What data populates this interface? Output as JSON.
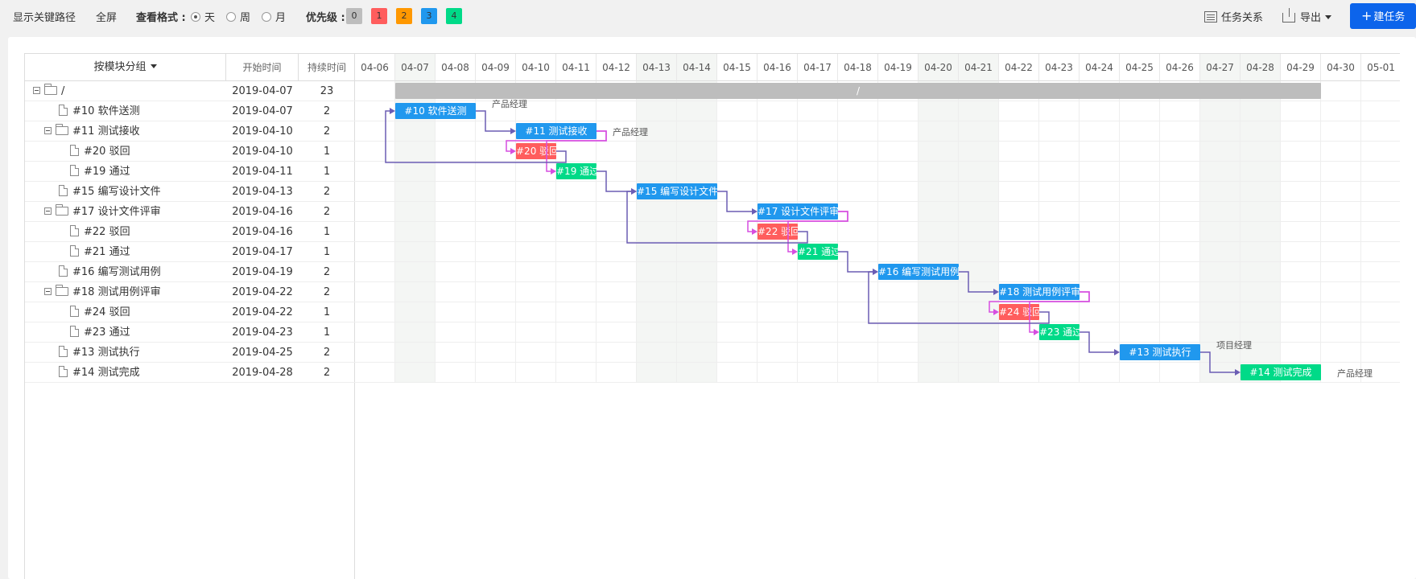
{
  "toolbar": {
    "critical_path": "显示关键路径",
    "fullscreen": "全屏",
    "view_format_label": "查看格式 :",
    "view_options": [
      "天",
      "周",
      "月"
    ],
    "view_selected": "天",
    "priority_label": "优先级 :",
    "priorities": [
      {
        "label": "0",
        "color": "#bdbdbd"
      },
      {
        "label": "1",
        "color": "#ff5d5d"
      },
      {
        "label": "2",
        "color": "#ff9800"
      },
      {
        "label": "3",
        "color": "#2098ee"
      },
      {
        "label": "4",
        "color": "#00da88"
      }
    ],
    "task_relations": "任务关系",
    "export": "导出",
    "new_task": "建任务"
  },
  "columns": {
    "group": "按模块分组",
    "start": "开始时间",
    "duration": "持续时间"
  },
  "days": [
    "04-06",
    "04-07",
    "04-08",
    "04-09",
    "04-10",
    "04-11",
    "04-12",
    "04-13",
    "04-14",
    "04-15",
    "04-16",
    "04-17",
    "04-18",
    "04-19",
    "04-20",
    "04-21",
    "04-22",
    "04-23",
    "04-24",
    "04-25",
    "04-26",
    "04-27",
    "04-28",
    "04-29",
    "04-30",
    "05-01"
  ],
  "weekend_days": [
    "04-07",
    "04-13",
    "04-14",
    "04-20",
    "04-21",
    "04-27",
    "04-28"
  ],
  "colors": {
    "gray": "#bdbdbd",
    "blue": "#2098ee",
    "red": "#ff5d5d",
    "green": "#00da88",
    "link_purple": "#6b5db4",
    "link_magenta": "#d64ee0"
  },
  "tasks": [
    {
      "name": "/",
      "start": "2019-04-07",
      "duration": "23",
      "kind": "folder",
      "level": 0,
      "bar_label": "/",
      "color": "gray",
      "assignee": ""
    },
    {
      "name": "#10 软件送测",
      "start": "2019-04-07",
      "duration": "2",
      "kind": "file",
      "level": 1,
      "bar_label": "#10 软件送测",
      "color": "blue",
      "assignee": "产品经理"
    },
    {
      "name": "#11 测试接收",
      "start": "2019-04-10",
      "duration": "2",
      "kind": "folder",
      "level": 1,
      "bar_label": "#11 测试接收",
      "color": "blue",
      "assignee": "产品经理"
    },
    {
      "name": "#20 驳回",
      "start": "2019-04-10",
      "duration": "1",
      "kind": "file",
      "level": 2,
      "bar_label": "#20 驳回",
      "color": "red",
      "assignee": ""
    },
    {
      "name": "#19 通过",
      "start": "2019-04-11",
      "duration": "1",
      "kind": "file",
      "level": 2,
      "bar_label": "#19 通过",
      "color": "green",
      "assignee": ""
    },
    {
      "name": "#15 编写设计文件",
      "start": "2019-04-13",
      "duration": "2",
      "kind": "file",
      "level": 1,
      "bar_label": "#15 编写设计文件",
      "color": "blue",
      "assignee": ""
    },
    {
      "name": "#17 设计文件评审",
      "start": "2019-04-16",
      "duration": "2",
      "kind": "folder",
      "level": 1,
      "bar_label": "#17 设计文件评审",
      "color": "blue",
      "assignee": ""
    },
    {
      "name": "#22 驳回",
      "start": "2019-04-16",
      "duration": "1",
      "kind": "file",
      "level": 2,
      "bar_label": "#22 驳回",
      "color": "red",
      "assignee": ""
    },
    {
      "name": "#21 通过",
      "start": "2019-04-17",
      "duration": "1",
      "kind": "file",
      "level": 2,
      "bar_label": "#21 通过",
      "color": "green",
      "assignee": ""
    },
    {
      "name": "#16 编写测试用例",
      "start": "2019-04-19",
      "duration": "2",
      "kind": "file",
      "level": 1,
      "bar_label": "#16 编写测试用例",
      "color": "blue",
      "assignee": ""
    },
    {
      "name": "#18 测试用例评审",
      "start": "2019-04-22",
      "duration": "2",
      "kind": "folder",
      "level": 1,
      "bar_label": "#18 测试用例评审",
      "color": "blue",
      "assignee": ""
    },
    {
      "name": "#24 驳回",
      "start": "2019-04-22",
      "duration": "1",
      "kind": "file",
      "level": 2,
      "bar_label": "#24 驳回",
      "color": "red",
      "assignee": ""
    },
    {
      "name": "#23 通过",
      "start": "2019-04-23",
      "duration": "1",
      "kind": "file",
      "level": 2,
      "bar_label": "#23 通过",
      "color": "green",
      "assignee": ""
    },
    {
      "name": "#13 测试执行",
      "start": "2019-04-25",
      "duration": "2",
      "kind": "file",
      "level": 1,
      "bar_label": "#13 测试执行",
      "color": "blue",
      "assignee": "项目经理"
    },
    {
      "name": "#14 测试完成",
      "start": "2019-04-28",
      "duration": "2",
      "kind": "file",
      "level": 1,
      "bar_label": "#14 测试完成",
      "color": "green",
      "assignee": "产品经理"
    }
  ],
  "links": [
    {
      "from": 1,
      "to": 2,
      "color": "link_purple"
    },
    {
      "from": 2,
      "to": 3,
      "color": "link_magenta"
    },
    {
      "from": 2,
      "to": 4,
      "color": "link_magenta"
    },
    {
      "from": 3,
      "to": 1,
      "color": "link_purple"
    },
    {
      "from": 4,
      "to": 5,
      "color": "link_purple"
    },
    {
      "from": 5,
      "to": 6,
      "color": "link_purple"
    },
    {
      "from": 6,
      "to": 7,
      "color": "link_magenta"
    },
    {
      "from": 6,
      "to": 8,
      "color": "link_magenta"
    },
    {
      "from": 7,
      "to": 5,
      "color": "link_purple"
    },
    {
      "from": 8,
      "to": 9,
      "color": "link_purple"
    },
    {
      "from": 9,
      "to": 10,
      "color": "link_purple"
    },
    {
      "from": 10,
      "to": 11,
      "color": "link_magenta"
    },
    {
      "from": 10,
      "to": 12,
      "color": "link_magenta"
    },
    {
      "from": 11,
      "to": 9,
      "color": "link_purple"
    },
    {
      "from": 12,
      "to": 13,
      "color": "link_purple"
    },
    {
      "from": 13,
      "to": 14,
      "color": "link_purple"
    }
  ]
}
